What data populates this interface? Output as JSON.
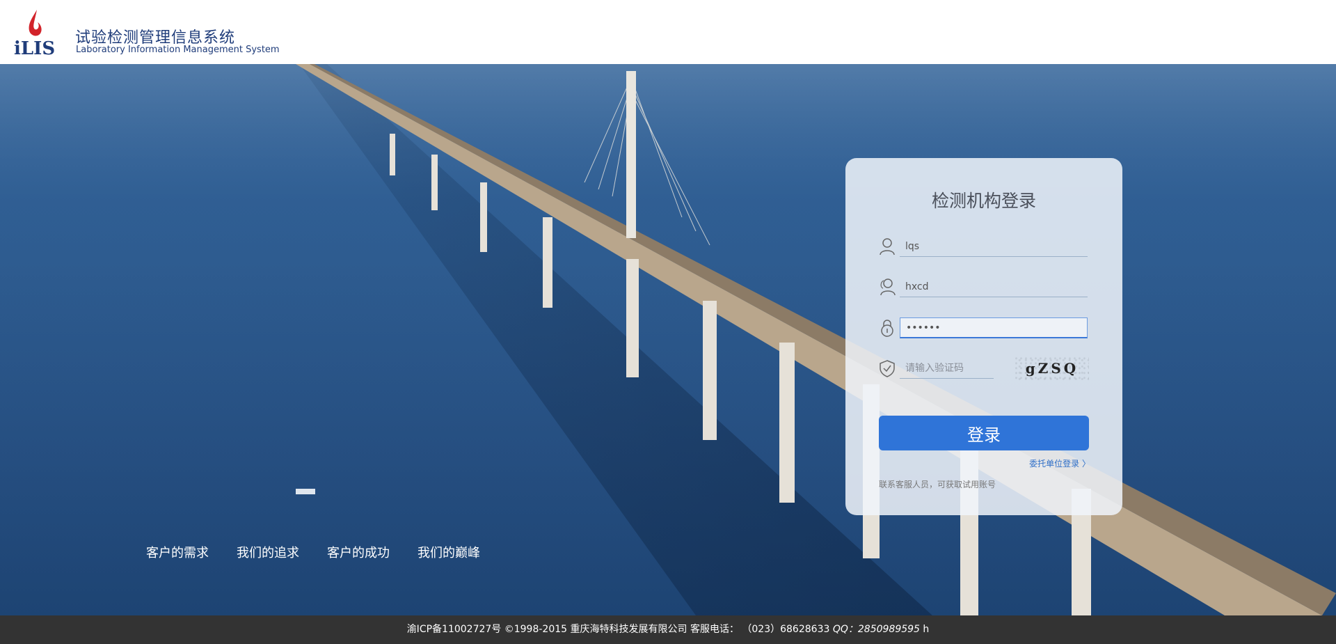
{
  "header": {
    "logo_text": "iLIS",
    "title": "试验检测管理信息系统",
    "subtitle": "Laboratory Information Management System"
  },
  "nav": {
    "items": [
      {
        "label": "客户的需求"
      },
      {
        "label": "我们的追求"
      },
      {
        "label": "客户的成功"
      },
      {
        "label": "我们的巅峰"
      }
    ]
  },
  "login": {
    "title": "检测机构登录",
    "org_value": "lqs",
    "user_value": "hxcd",
    "password_value": "••••••",
    "captcha_placeholder": "请输入验证码",
    "captcha_text": "gZSQ",
    "submit_label": "登录",
    "entrust_link": "委托单位登录 〉",
    "contact_note": "联系客服人员，可获取试用账号"
  },
  "footer": {
    "text": "渝ICP备11002727号 ©1998-2015 重庆海特科技发展有限公司 客服电话： （023）68628633",
    "qq": "QQ：2850989595",
    "suffix": "h"
  },
  "colors": {
    "brand_blue": "#1f3c7a",
    "button_blue": "#2f74d8",
    "footer_bg": "#333333",
    "logo_red": "#d2232a"
  }
}
